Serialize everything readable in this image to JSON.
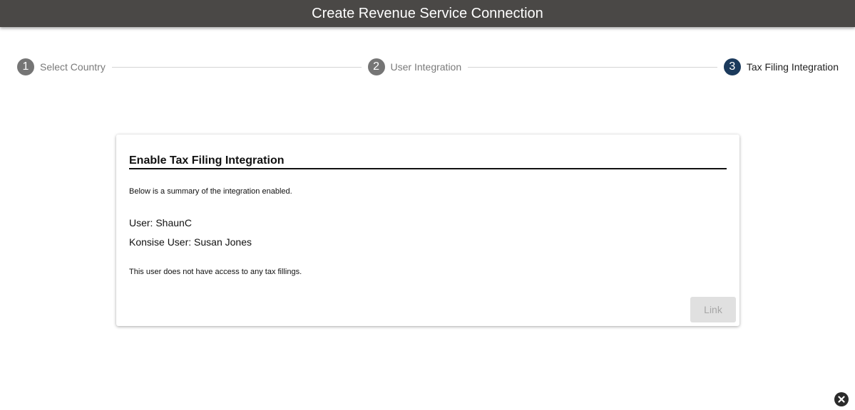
{
  "header": {
    "title": "Create Revenue Service Connection"
  },
  "stepper": {
    "steps": [
      {
        "number": "1",
        "label": "Select Country",
        "state": "completed"
      },
      {
        "number": "2",
        "label": "User Integration",
        "state": "completed"
      },
      {
        "number": "3",
        "label": "Tax Filing Integration",
        "state": "active"
      }
    ]
  },
  "card": {
    "title": "Enable Tax Filing Integration",
    "summary": "Below is a summary of the integration enabled.",
    "user": "User: ShaunC",
    "konsise_user": "Konsise User: Susan Jones",
    "access_note": "This user does not have access to any tax fillings.",
    "link_label": "Link"
  },
  "icons": {
    "close": "close-circle-icon"
  },
  "colors": {
    "header_bg": "#4a4846",
    "step_active": "#1b3a5c",
    "step_inactive": "#757575"
  }
}
